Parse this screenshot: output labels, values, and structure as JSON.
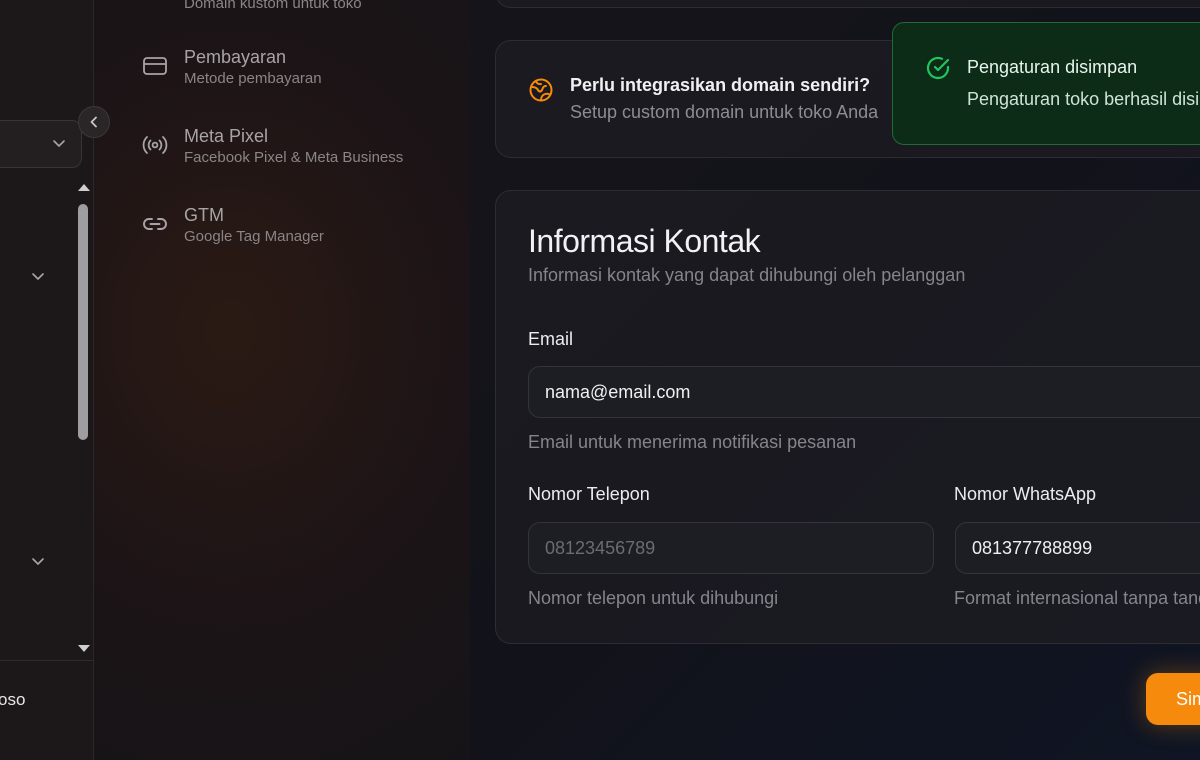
{
  "sidebar": {
    "user_name": "oso"
  },
  "settings_nav": {
    "items": [
      {
        "title": "Pembayaran",
        "subtitle": "Metode pembayaran",
        "icon": "credit-card-icon"
      },
      {
        "title": "Meta Pixel",
        "subtitle": "Facebook Pixel & Meta Business",
        "icon": "broadcast-icon"
      },
      {
        "title": "GTM",
        "subtitle": "Google Tag Manager",
        "icon": "link-icon"
      }
    ],
    "partial_top_subtitle": "Domain kustom untuk toko"
  },
  "domain_card": {
    "title": "Perlu integrasikan domain sendiri?",
    "subtitle": "Setup custom domain untuk toko Anda",
    "icon": "globe-icon"
  },
  "contact": {
    "title": "Informasi Kontak",
    "subtitle": "Informasi kontak yang dapat dihubungi oleh pelanggan",
    "email": {
      "label": "Email",
      "value": "nama@email.com",
      "hint": "Email untuk menerima notifikasi pesanan"
    },
    "phone": {
      "label": "Nomor Telepon",
      "value": "",
      "placeholder": "08123456789",
      "hint": "Nomor telepon untuk dihubungi"
    },
    "whatsapp": {
      "label": "Nomor WhatsApp",
      "value": "081377788899",
      "hint": "Format internasional tanpa tanda +"
    }
  },
  "toast": {
    "title": "Pengaturan disimpan",
    "message": "Pengaturan toko berhasil disimpan",
    "icon": "check-circle-icon",
    "color": "#0c2c18"
  },
  "save_button": {
    "label": "Simpan",
    "icon": "save-icon",
    "color": "#f58a0c"
  },
  "colors": {
    "accent": "#f58a0c",
    "success": "#22c55e"
  }
}
